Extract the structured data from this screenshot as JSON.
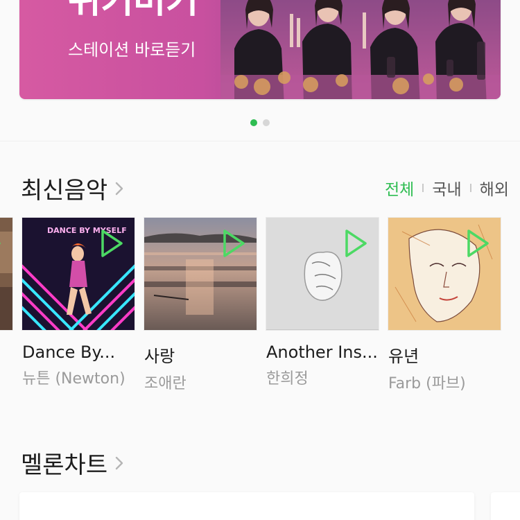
{
  "banner": {
    "title": "위키미키",
    "subtitle": "스테이션 바로듣기",
    "page_count": 2,
    "active_page": 1
  },
  "new_music": {
    "title": "최신음악",
    "filters": [
      {
        "label": "전체",
        "active": true
      },
      {
        "label": "국내",
        "active": false
      },
      {
        "label": "해외",
        "active": false
      }
    ],
    "albums": [
      {
        "title": "Dance By...",
        "artist": "뉴튼 (Newton)",
        "cover_text": "DANCE BY MYSELF"
      },
      {
        "title": "사랑",
        "artist": "조애란"
      },
      {
        "title": "Another Ins...",
        "artist": "한희정"
      },
      {
        "title": "유년",
        "artist": "Farb (파브)"
      }
    ]
  },
  "melon_chart": {
    "title": "멜론차트"
  },
  "colors": {
    "accent": "#2fbd52",
    "banner": "#c8509f"
  },
  "icons": {
    "play": "play-outline-icon",
    "chevron": "chevron-right-icon"
  }
}
